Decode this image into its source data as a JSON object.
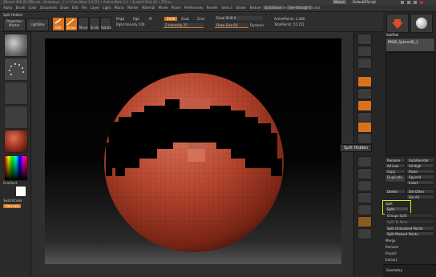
{
  "title_bar": {
    "text": "ZBrush 4R6  [D:\\ZBrush...\\Autosave...]   •••  Free Mem 3.4723 • Active Mem 1.2  • Scratch Disk 42 • ZTime"
  },
  "menu": {
    "items": [
      "Alpha",
      "Brush",
      "Color",
      "Document",
      "Draw",
      "Edit",
      "File",
      "Layer",
      "Light",
      "Macro",
      "Marker",
      "Material",
      "Movie",
      "Picker",
      "Preferences",
      "Render",
      "Stencil",
      "Stroke",
      "Texture",
      "Tool",
      "Transform",
      "Zplugin",
      "Zscript"
    ],
    "quicksave": "QuickSave",
    "see_through": "See-through  0",
    "menus": "Menus",
    "default_script": "DefaultZScript"
  },
  "toolbar": {
    "projection_master": "Projection Master",
    "lightbox": "LightBox",
    "edit": "Edit",
    "draw": "Draw",
    "move": "Move",
    "scale": "Scale",
    "rotate": "Rotate",
    "mrgb": "Mrgb",
    "rgb": "Rgb",
    "m": "M",
    "zadd": "Zadd",
    "zsub": "Zsub",
    "zcut": "Zcut",
    "focal_shift": "Focal Shift 0",
    "z_intensity": "Z Intensity 25",
    "draw_size": "Draw Size 64",
    "dynamic": "Dynamic",
    "rgb_intensity": "Rgb Intensity 100",
    "active_points": "ActivePoints: 1,466",
    "total_points": "TotalPoints: 55,151"
  },
  "split_hidden_subpalette_label": "Split Hidden",
  "left_shelf": {
    "gradient": "Gradient",
    "switch_color": "SwitchColor",
    "alternate": "Alternate"
  },
  "right_shelf": {
    "buttons": [
      "BPR",
      "SPix 3",
      "Scroll",
      "Zoom",
      "Actual",
      "AAHalf",
      "Persp",
      "Floor",
      "Local",
      "LSym",
      "Xyz",
      "Frame",
      "Move",
      "Scale",
      "Rotate",
      "PolyF",
      "Transp",
      "Solo",
      "Xpose"
    ],
    "tooltip": "Split Hidden"
  },
  "subtool_panel": {
    "header": "SubTool",
    "subtool_name": "PM3D_Sphere3D_1",
    "list_all": "List All",
    "rename": "Rename",
    "autoreorder": "AutoReorder",
    "all_low": "All Low",
    "all_high": "All High",
    "copy": "Copy",
    "paste": "Paste",
    "duplicate": "Duplicate",
    "append": "Append",
    "insert": "Insert",
    "delete": "Delete",
    "del_other": "Del Other",
    "del_all": "Del All",
    "split_header": "Split",
    "split_hidden": "Split Hidden",
    "groups_split": "Groups Split",
    "split_to_parts": "Split To Parts",
    "split_unmasked_points": "Split Unmasked Points",
    "split_masked_points": "Split Masked Points",
    "merge": "Merge",
    "remesh": "Remesh",
    "project": "Project",
    "extract": "Extract",
    "geometry": "Geometry"
  },
  "colors": {
    "accent_orange": "#d8731c",
    "sphere": "#b8462f",
    "highlight_box": "#e5e51a",
    "panel_bg": "#262626"
  },
  "icons": [
    "tool-thumb-icon",
    "sphere-icon",
    "brush-icon",
    "stroke-icon",
    "alpha-icon",
    "material-icon",
    "color-picker-icon",
    "snake-icon",
    "star-icon",
    "cylinder-icon"
  ]
}
